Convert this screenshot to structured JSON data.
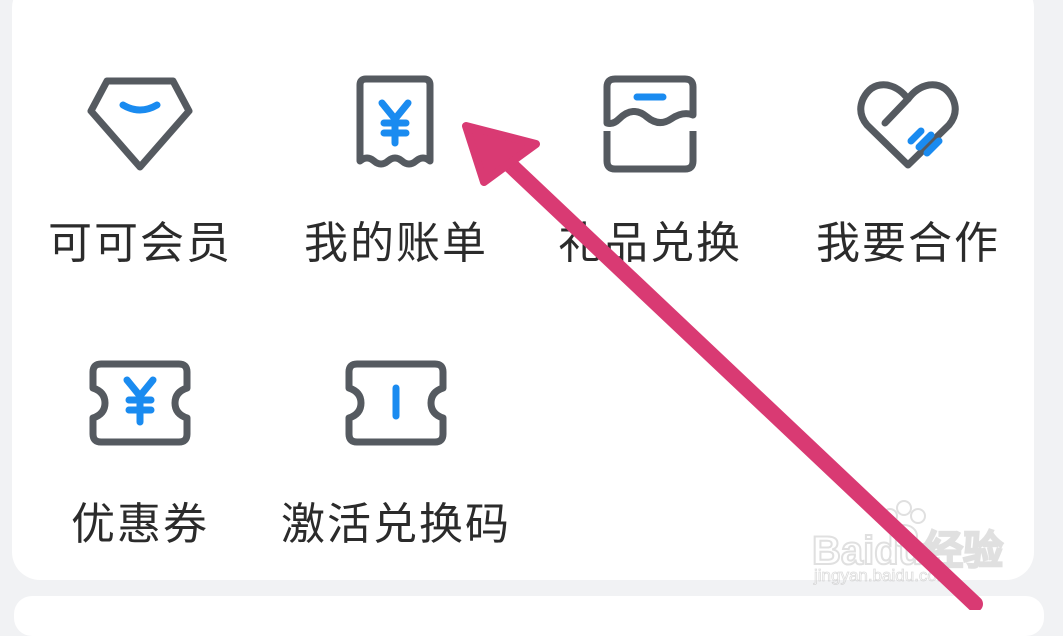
{
  "menu": {
    "items": [
      {
        "label": "可可会员",
        "icon": "diamond-icon"
      },
      {
        "label": "我的账单",
        "icon": "receipt-yen-icon"
      },
      {
        "label": "礼品兑换",
        "icon": "gift-box-icon"
      },
      {
        "label": "我要合作",
        "icon": "heart-handshake-icon"
      },
      {
        "label": "优惠券",
        "icon": "coupon-yen-icon"
      },
      {
        "label": "激活兑换码",
        "icon": "ticket-code-icon"
      }
    ]
  },
  "watermark": {
    "brand": "Baidu经验",
    "url": "jingyan.baidu.com"
  },
  "colors": {
    "icon_stroke": "#555a60",
    "icon_accent": "#1a8bf0",
    "text": "#2b2b2b",
    "annotation_arrow": "#d93a73",
    "background": "#f1f2f4",
    "card": "#ffffff"
  }
}
